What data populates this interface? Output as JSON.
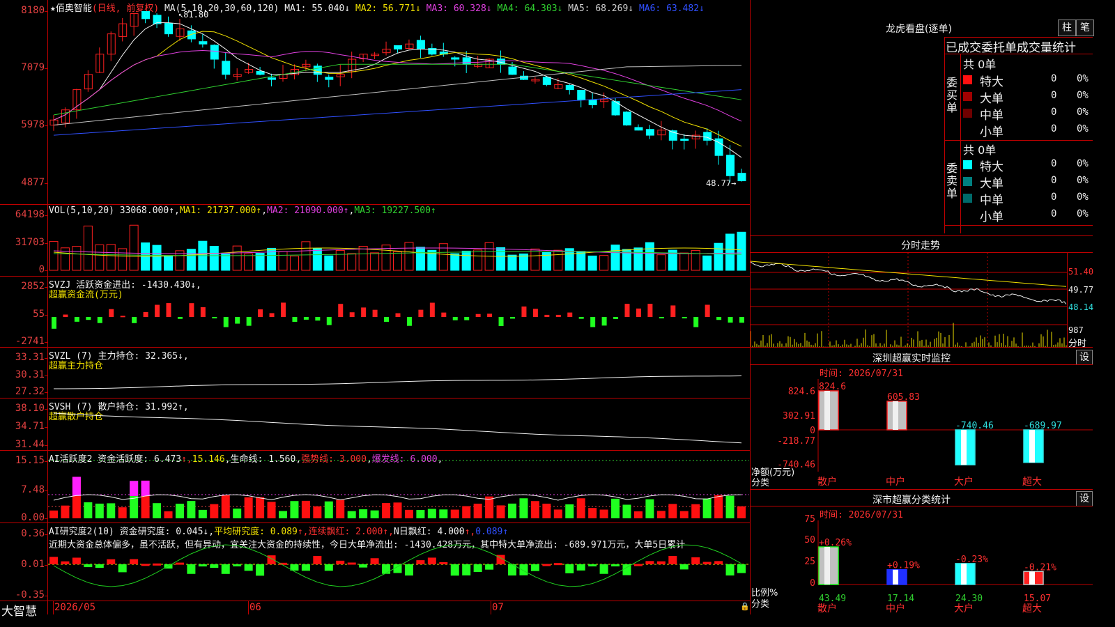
{
  "main": {
    "star": "★",
    "stock_name": "佰奥智能",
    "period": "(日线, 前复权)",
    "ma_label": "MA(5,10,20,30,60,120)",
    "ma": [
      {
        "label": "MA1: 55.040↓",
        "color": "#f0f0f0"
      },
      {
        "label": "MA2: 56.771↓",
        "color": "#f0e000"
      },
      {
        "label": "MA3: 60.328↓",
        "color": "#e040e0"
      },
      {
        "label": "MA4: 64.303↓",
        "color": "#30d030"
      },
      {
        "label": "MA5: 68.269↓",
        "color": "#d0d0d0"
      },
      {
        "label": "MA6: 63.482↓",
        "color": "#3050ff"
      }
    ],
    "y_ticks": [
      "8180",
      "7079",
      "5978",
      "4877"
    ],
    "high_marker": "81.80",
    "low_marker": "48.77→"
  },
  "vol": {
    "title": "VOL(5,10,20)",
    "value": "33068.000↑",
    "ma": [
      {
        "label": "MA1: 21737.000↑",
        "color": "#f0e000"
      },
      {
        "label": "MA2: 21090.000↑",
        "color": "#e040e0"
      },
      {
        "label": "MA3: 19227.500↑",
        "color": "#30d030"
      }
    ],
    "y_ticks": [
      "64198",
      "31703",
      "0"
    ]
  },
  "svzj": {
    "title": "SVZJ  活跃资金进出: -1430.430↓,",
    "subtitle": "超赢资金流(万元)",
    "y_ticks": [
      "2852",
      "55",
      "-2741"
    ]
  },
  "svzl": {
    "title": "SVZL (7) 主力持仓: 32.365↓,",
    "subtitle": "超赢主力持仓",
    "y_ticks": [
      "33.31",
      "30.31",
      "27.32"
    ]
  },
  "svsh": {
    "title": "SVSH (7) 散户持仓: 31.992↑,",
    "subtitle": "超赢散户持仓",
    "y_ticks": [
      "38.10",
      "34.71",
      "31.44"
    ]
  },
  "ai1": {
    "title_white": "AI活跃度2 资金活跃度: 6.473",
    "parts": [
      {
        "label": "↑,",
        "color": "#ff3030"
      },
      {
        "label": "15.146",
        "color": "#f0e000"
      },
      {
        "label": ",",
        "color": "#f0f0f0"
      },
      {
        "label": "生命线: 1.560",
        "color": "#f0f0f0"
      },
      {
        "label": ",",
        "color": "#f0f0f0"
      },
      {
        "label": "强势线: 3.000",
        "color": "#ff3030"
      },
      {
        "label": ",",
        "color": "#f0f0f0"
      },
      {
        "label": "爆发线: 6.000",
        "color": "#e040e0"
      },
      {
        "label": ",",
        "color": "#f0f0f0"
      }
    ],
    "y_ticks": [
      "15.15",
      "7.48",
      "0.00"
    ]
  },
  "ai2": {
    "title_white": "AI研究度2(10) 资金研究度: 0.045↓,",
    "parts": [
      {
        "label": "平均研究度: 0.089",
        "color": "#f0e000"
      },
      {
        "label": "↑,",
        "color": "#ff3030"
      },
      {
        "label": "连续飘红: 2.000",
        "color": "#ff3030"
      },
      {
        "label": "↑,",
        "color": "#ff3030"
      },
      {
        "label": "N日飘红: 4.000",
        "color": "#f0f0f0"
      },
      {
        "label": "↑,",
        "color": "#ff3030"
      },
      {
        "label": "0.089↑",
        "color": "#3050ff"
      }
    ],
    "comment": "近期大资金总体偏多，虽不活跃，但有异动，宜关注大资金的持续性，今日大单净流出: -1430.428万元，其中特大单净流出: -689.971万元，大单5日累计",
    "y_ticks": [
      "0.36",
      "0.01",
      "-0.35"
    ]
  },
  "xaxis": {
    "brand": "大智慧",
    "labels": [
      "2026/05",
      "06",
      "07"
    ]
  },
  "right": {
    "lhb_title": "龙虎看盘(逐单)",
    "btn_bar": "柱",
    "btn_pen": "笔",
    "stats_title": "已成交委托单成交量统计",
    "buy": {
      "side_label": "委买单",
      "total": "共 0单",
      "rows": [
        {
          "name": "特大",
          "val": "0",
          "pct": "0%",
          "color": "#ff1010"
        },
        {
          "name": "大单",
          "val": "0",
          "pct": "0%",
          "color": "#a00000"
        },
        {
          "name": "中单",
          "val": "0",
          "pct": "0%",
          "color": "#700000"
        },
        {
          "name": "小单",
          "val": "0",
          "pct": "0%",
          "color": ""
        }
      ]
    },
    "sell": {
      "side_label": "委卖单",
      "total": "共 0单",
      "rows": [
        {
          "name": "特大",
          "val": "0",
          "pct": "0%",
          "color": "#00ffff"
        },
        {
          "name": "大单",
          "val": "0",
          "pct": "0%",
          "color": "#008080"
        },
        {
          "name": "中单",
          "val": "0",
          "pct": "0%",
          "color": "#006a6a"
        },
        {
          "name": "小单",
          "val": "0",
          "pct": "0%",
          "color": ""
        }
      ]
    },
    "fenshi": {
      "title": "分时走势",
      "y_ticks": [
        "51.40",
        "49.77",
        "48.14"
      ],
      "vol_tick": "987",
      "vol_label": "分时"
    },
    "monitor": {
      "title": "深圳超赢实时监控",
      "btn": "设",
      "time": "时间: 2026/07/31",
      "y_ticks": [
        "824.6",
        "302.91",
        "0",
        "-218.77",
        "-740.46"
      ],
      "y_title": "净额(万元)",
      "cat_title": "分类",
      "bars": [
        {
          "cat": "散户",
          "value": 824.6,
          "label": "824.6"
        },
        {
          "cat": "中户",
          "value": 605.83,
          "label": "605.83"
        },
        {
          "cat": "大户",
          "value": -740.46,
          "label": "-740.46"
        },
        {
          "cat": "超大",
          "value": -689.97,
          "label": "-689.97"
        }
      ]
    },
    "classify": {
      "title": "深市超赢分类统计",
      "btn": "设",
      "time": "时间: 2026/07/31",
      "y_ticks": [
        "75",
        "50",
        "25",
        "0"
      ],
      "y_title": "比例%",
      "cat_title": "分类",
      "bars": [
        {
          "cat": "散户",
          "value": 43.49,
          "label": "43.49",
          "change": "+0.26%"
        },
        {
          "cat": "中户",
          "value": 17.14,
          "label": "17.14",
          "change": "+0.19%"
        },
        {
          "cat": "大户",
          "value": 24.3,
          "label": "24.30",
          "change": "-0.23%"
        },
        {
          "cat": "超大",
          "value": 15.07,
          "label": "15.07",
          "change": "-0.21%"
        }
      ]
    }
  },
  "colors": {
    "up": "#ff2020",
    "down": "#00ffff",
    "frame": "#c00000"
  }
}
